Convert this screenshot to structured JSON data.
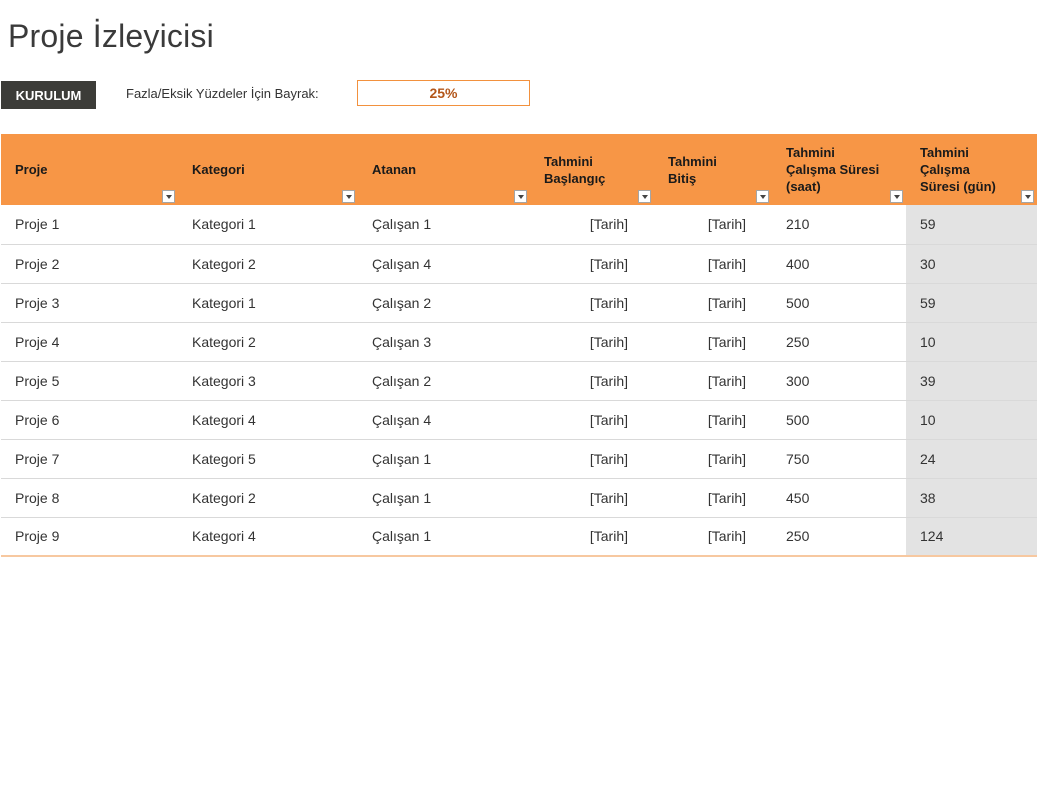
{
  "title": "Proje İzleyicisi",
  "setup_button": "KURULUM",
  "flag": {
    "label": "Fazla/Eksik Yüzdeler İçin Bayrak:",
    "value": "25%"
  },
  "colors": {
    "header_bg": "#f79646",
    "button_bg": "#3c3c38",
    "shaded_col": "#e3e3e3"
  },
  "columns": [
    "Proje",
    "Kategori",
    "Atanan",
    "Tahmini Başlangıç",
    "Tahmini Bitiş",
    "Tahmini Çalışma Süresi (saat)",
    "Tahmini Çalışma Süresi (gün)"
  ],
  "rows": [
    [
      "Proje 1",
      "Kategori 1",
      "Çalışan 1",
      "[Tarih]",
      "[Tarih]",
      "210",
      "59"
    ],
    [
      "Proje 2",
      "Kategori 2",
      "Çalışan 4",
      "[Tarih]",
      "[Tarih]",
      "400",
      "30"
    ],
    [
      "Proje 3",
      "Kategori 1",
      "Çalışan 2",
      "[Tarih]",
      "[Tarih]",
      "500",
      "59"
    ],
    [
      "Proje 4",
      "Kategori 2",
      "Çalışan 3",
      "[Tarih]",
      "[Tarih]",
      "250",
      "10"
    ],
    [
      "Proje 5",
      "Kategori 3",
      "Çalışan 2",
      "[Tarih]",
      "[Tarih]",
      "300",
      "39"
    ],
    [
      "Proje 6",
      "Kategori 4",
      "Çalışan 4",
      "[Tarih]",
      "[Tarih]",
      "500",
      "10"
    ],
    [
      "Proje 7",
      "Kategori 5",
      "Çalışan 1",
      "[Tarih]",
      "[Tarih]",
      "750",
      "24"
    ],
    [
      "Proje 8",
      "Kategori 2",
      "Çalışan 1",
      "[Tarih]",
      "[Tarih]",
      "450",
      "38"
    ],
    [
      "Proje 9",
      "Kategori 4",
      "Çalışan 1",
      "[Tarih]",
      "[Tarih]",
      "250",
      "124"
    ]
  ]
}
